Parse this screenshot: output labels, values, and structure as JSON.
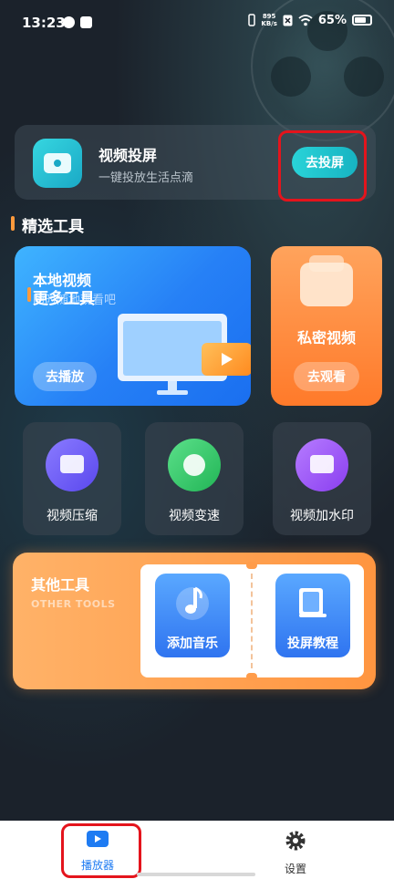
{
  "status_bar": {
    "time": "13:23",
    "net_speed_value": "895",
    "net_speed_unit": "KB/s",
    "battery": "65%"
  },
  "cast": {
    "title": "视频投屏",
    "subtitle": "一键投放生活点滴",
    "button": "去投屏"
  },
  "featured": {
    "title": "精选工具"
  },
  "local_video": {
    "title": "本地视频",
    "subtitle": "随时随地观看吧",
    "button": "去播放"
  },
  "more_tools_label": "更多工具",
  "private_video": {
    "title": "私密视频",
    "button": "去观看"
  },
  "tools": [
    {
      "label": "视频压缩",
      "icon": "compress-icon",
      "color": "#6a5cf0"
    },
    {
      "label": "视频变速",
      "icon": "speed-icon",
      "color": "#37c96a"
    },
    {
      "label": "视频加水印",
      "icon": "watermark-icon",
      "color": "#9b4df0"
    }
  ],
  "other_tools": {
    "title": "其他工具",
    "subtitle": "OTHER TOOLS",
    "items": [
      {
        "label": "添加音乐",
        "icon": "music-note-icon"
      },
      {
        "label": "投屏教程",
        "icon": "book-icon"
      }
    ]
  },
  "bottom_nav": [
    {
      "label": "播放器",
      "icon": "player-icon",
      "active": true
    },
    {
      "label": "设置",
      "icon": "gear-icon",
      "active": false
    }
  ],
  "colors": {
    "accent_teal": "#29d3d8",
    "accent_orange": "#ff9540",
    "accent_blue": "#2f74f0",
    "highlight_red": "#e4141c",
    "nav_active": "#1e7bf2"
  }
}
